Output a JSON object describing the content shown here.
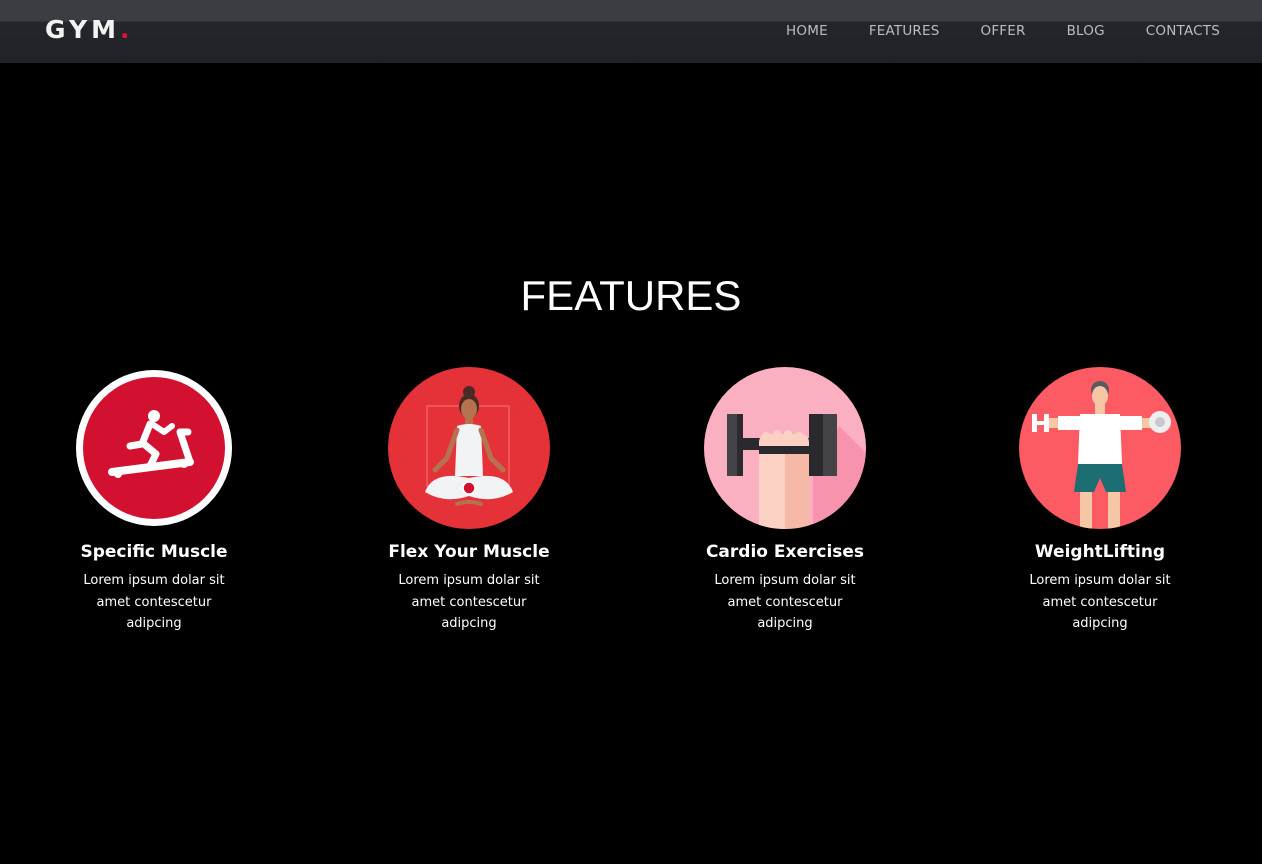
{
  "brand": {
    "name": "GYM",
    "dot": ".",
    "accent_color": "#e0142c"
  },
  "nav": {
    "items": [
      {
        "label": "HOME"
      },
      {
        "label": "FEATURES"
      },
      {
        "label": "OFFER"
      },
      {
        "label": "BLOG"
      },
      {
        "label": "CONTACTS"
      }
    ]
  },
  "features_section": {
    "title": "FEATURES",
    "items": [
      {
        "icon": "treadmill-icon",
        "title": "Specific Muscle",
        "text": "Lorem ipsum dolar sit amet contescetur adipcing"
      },
      {
        "icon": "yoga-icon",
        "title": "Flex Your Muscle",
        "text": "Lorem ipsum dolar sit amet contescetur adipcing"
      },
      {
        "icon": "dumbbell-icon",
        "title": "Cardio Exercises",
        "text": "Lorem ipsum dolar sit amet contescetur adipcing"
      },
      {
        "icon": "weightlifting-icon",
        "title": "WeightLifting",
        "text": "Lorem ipsum dolar sit amet contescetur adipcing"
      }
    ]
  }
}
